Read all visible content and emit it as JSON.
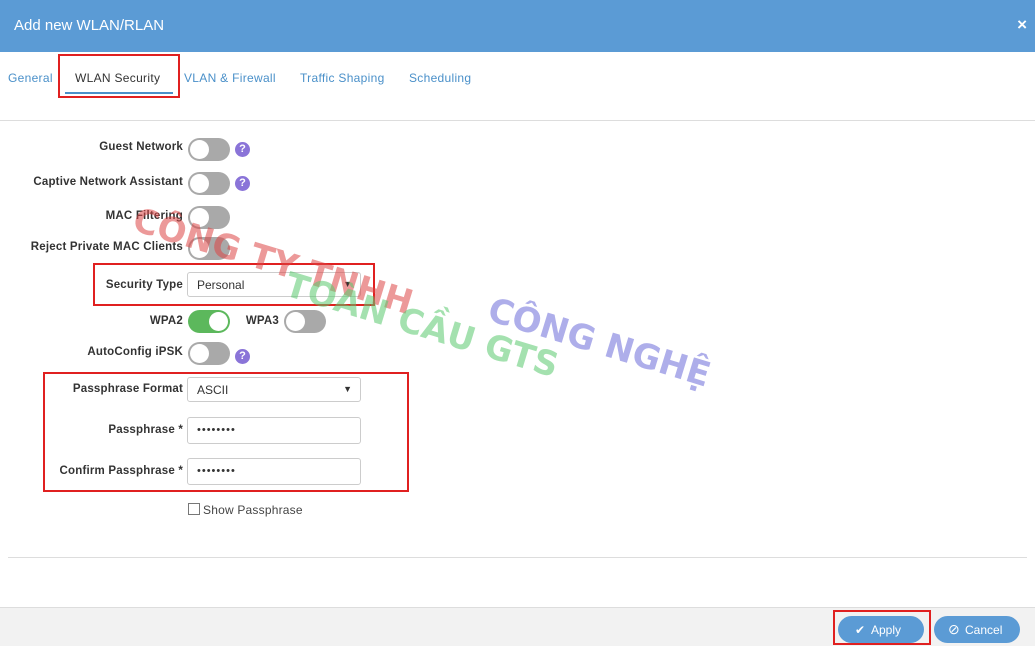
{
  "dialog": {
    "title": "Add new WLAN/RLAN",
    "close_glyph": "×"
  },
  "tabs": [
    {
      "label": "General"
    },
    {
      "label": "WLAN Security"
    },
    {
      "label": "VLAN & Firewall"
    },
    {
      "label": "Traffic Shaping"
    },
    {
      "label": "Scheduling"
    }
  ],
  "active_tab": "WLAN Security",
  "form": {
    "guest_network": {
      "label": "Guest Network",
      "on": false
    },
    "captive_network_assistant": {
      "label": "Captive Network Assistant",
      "on": false
    },
    "mac_filtering": {
      "label": "MAC Filtering",
      "on": false
    },
    "reject_private_mac": {
      "label": "Reject Private MAC Clients",
      "on": false
    },
    "security_type": {
      "label": "Security Type",
      "value": "Personal"
    },
    "wpa2": {
      "label": "WPA2",
      "on": true
    },
    "wpa3": {
      "label": "WPA3",
      "on": false
    },
    "autoconfig_ipsk": {
      "label": "AutoConfig iPSK",
      "on": false
    },
    "passphrase_format": {
      "label": "Passphrase Format",
      "value": "ASCII"
    },
    "passphrase": {
      "label": "Passphrase *",
      "value": "••••••••"
    },
    "confirm_passphrase": {
      "label": "Confirm Passphrase *",
      "value": "••••••••"
    },
    "show_passphrase": {
      "label": "Show Passphrase",
      "checked": false
    },
    "help_glyph": "?",
    "dropdown_glyph": "▼"
  },
  "buttons": {
    "apply": {
      "label": "Apply",
      "glyph": "✔"
    },
    "cancel": {
      "label": "Cancel",
      "glyph": "⊘"
    }
  },
  "watermark": {
    "line1a": "CÔNG TY TNHH",
    "line1b": "CÔNG NGHỆ",
    "line2": "TOÀN CẦU GTS"
  },
  "colors": {
    "header": "#5b9bd5",
    "toggle_on": "#5cb85c",
    "toggle_off": "#a9a9a9",
    "help": "#8a74d8",
    "highlight": "#e02020"
  }
}
